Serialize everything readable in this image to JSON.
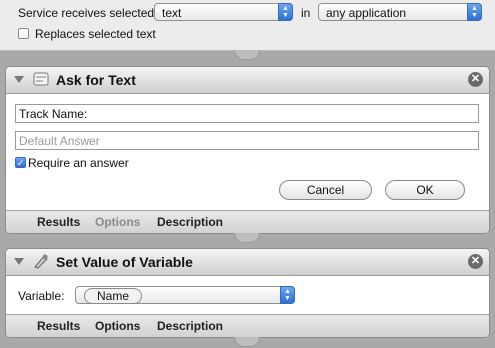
{
  "header": {
    "service_label": "Service receives selected",
    "input_type": "text",
    "in_label": "in",
    "application": "any application",
    "replaces_label": "Replaces selected text",
    "replaces_checked": false
  },
  "actions": [
    {
      "title": "Ask for Text",
      "question_value": "Track Name:",
      "default_placeholder": "Default Answer",
      "require_label": "Require an answer",
      "require_checked": true,
      "cancel_label": "Cancel",
      "ok_label": "OK",
      "footer": {
        "results": "Results",
        "options": "Options",
        "description": "Description"
      }
    },
    {
      "title": "Set Value of Variable",
      "variable_label": "Variable:",
      "variable_value": "Name",
      "footer": {
        "results": "Results",
        "options": "Options",
        "description": "Description"
      }
    }
  ],
  "icons": {
    "close": "close-icon",
    "disclosure": "disclosure-triangle-icon",
    "ask_text": "text-dialog-icon",
    "set_variable": "variable-icon",
    "popup": "popup-arrows-icon"
  }
}
